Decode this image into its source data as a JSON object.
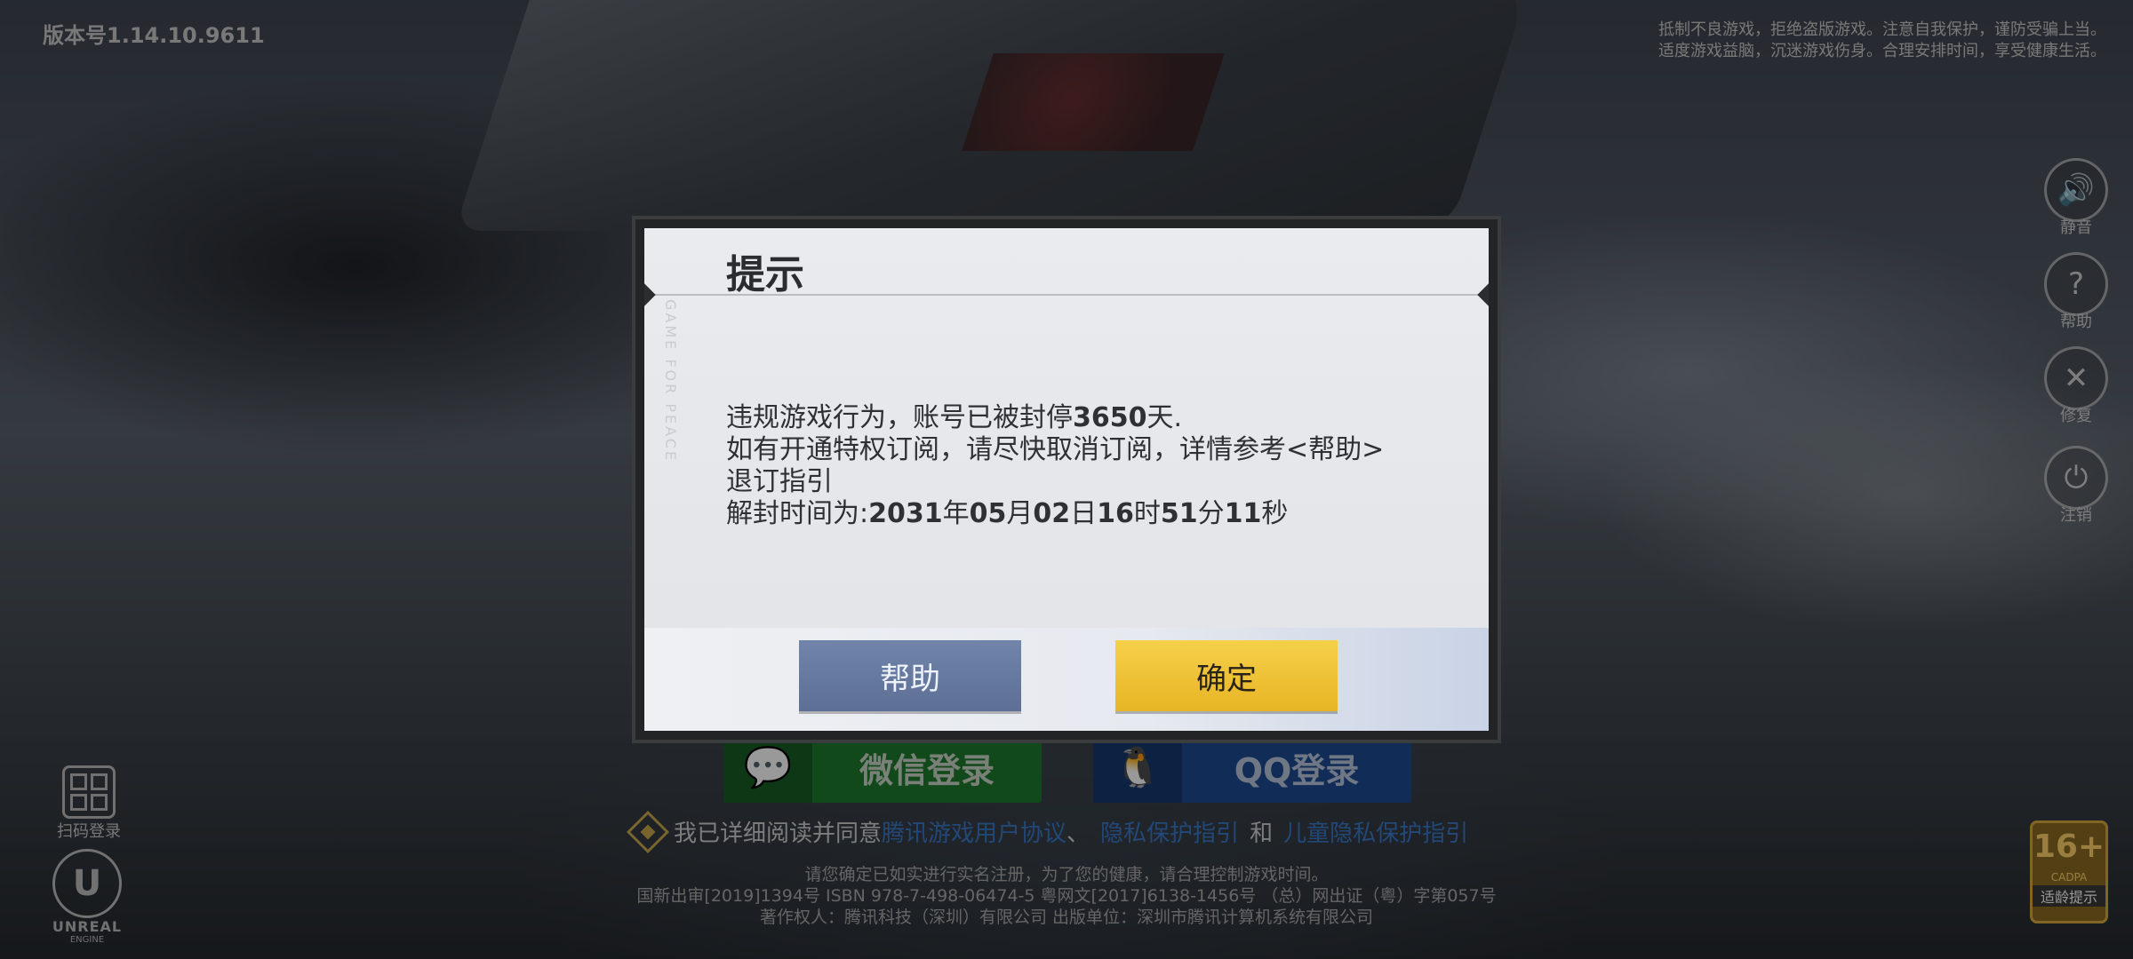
{
  "version": "版本号1.14.10.9611",
  "notice": [
    "抵制不良游戏，拒绝盗版游戏。注意自我保护，谨防受骗上当。",
    "适度游戏益脑，沉迷游戏伤身。合理安排时间，享受健康生活。"
  ],
  "side_buttons": [
    {
      "icon": "speaker-icon",
      "glyph": "🔊",
      "label": "静音"
    },
    {
      "icon": "help-icon",
      "glyph": "?",
      "label": "帮助"
    },
    {
      "icon": "repair-icon",
      "glyph": "✕",
      "label": "修复"
    },
    {
      "icon": "power-icon",
      "glyph": "⏻",
      "label": "注销"
    }
  ],
  "qr_login_label": "扫码登录",
  "engine": {
    "logo": "U",
    "text": "UNREAL",
    "sub": "ENGINE"
  },
  "login": {
    "wechat": "微信登录",
    "qq": "QQ登录"
  },
  "agreement": {
    "prefix": "我已详细阅读并同意",
    "link1": "腾讯游戏用户协议",
    "sep1": "、",
    "link2": "隐私保护指引",
    "sep2": "和",
    "link3": "儿童隐私保护指引"
  },
  "footer": [
    "请您确定已如实进行实名注册，为了您的健康，请合理控制游戏时间。",
    "国新出审[2019]1394号  ISBN 978-7-498-06474-5  粤网文[2017]6138-1456号 （总）网出证（粤）字第057号",
    "著作权人：腾讯科技（深圳）有限公司  出版单位：深圳市腾讯计算机系统有限公司"
  ],
  "age_rating": {
    "number": "16+",
    "org": "CADPA",
    "label": "适龄提示"
  },
  "dialog": {
    "title": "提示",
    "watermark": "GAME FOR PEACE",
    "line1_a": "违规游戏行为，账号已被封停",
    "line1_b": "3650",
    "line1_c": "天.",
    "line2": "如有开通特权订阅，请尽快取消订阅，详情参考<帮助>",
    "line3": "退订指引",
    "line4_prefix": "解封时间为:",
    "unban": {
      "year": "2031",
      "month": "05",
      "day": "02",
      "hour": "16",
      "minute": "51",
      "second": "11"
    },
    "units": {
      "year": "年",
      "month": "月",
      "day": "日",
      "hour": "时",
      "minute": "分",
      "second": "秒"
    },
    "help_label": "帮助",
    "ok_label": "确定"
  },
  "colors": {
    "help_button": "#6477a0",
    "ok_button": "#f0c33a",
    "link": "#3a78c9"
  }
}
